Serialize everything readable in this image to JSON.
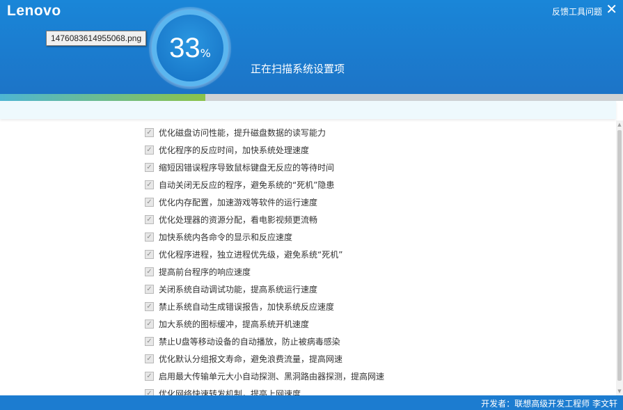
{
  "header": {
    "logo": "Lenovo",
    "feedback_label": "反馈工具问题",
    "close_glyph": "✕",
    "tooltip": "1476083614955068.png",
    "progress_percent": "33",
    "percent_sign": "%",
    "status": "正在扫描系统设置项"
  },
  "progress": {
    "fraction": 0.33
  },
  "items": [
    "优化磁盘访问性能，提升磁盘数据的读写能力",
    "优化程序的反应时间，加快系统处理速度",
    "缩短因错误程序导致鼠标键盘无反应的等待时间",
    "自动关闭无反应的程序，避免系统的“死机”隐患",
    "优化内存配置，加速游戏等软件的运行速度",
    "优化处理器的资源分配，看电影视频更流畅",
    "加快系统内各命令的显示和反应速度",
    "优化程序进程，独立进程优先级，避免系统“死机”",
    "提高前台程序的响应速度",
    "关闭系统自动调试功能，提高系统运行速度",
    "禁止系统自动生成错误报告，加快系统反应速度",
    "加大系统的图标缓冲，提高系统开机速度",
    "禁止U盘等移动设备的自动播放，防止被病毒感染",
    "优化默认分组报文寿命，避免浪费流量，提高网速",
    "启用最大传输单元大小自动探测、黑洞路由器探测，提高网速",
    "优化网络快速转发机制，提高上网速度"
  ],
  "checkbox_glyph": "✓",
  "footer": {
    "text": "开发者：联想高级开发工程师 李文轩"
  },
  "colors": {
    "header": "#1a86d8",
    "progress_start": "#4eb5d3",
    "progress_end": "#8bc34a",
    "footer": "#1c7cd0"
  }
}
